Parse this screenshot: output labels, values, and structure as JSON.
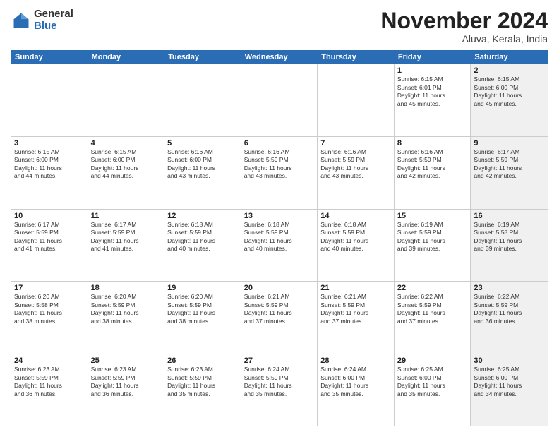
{
  "logo": {
    "general": "General",
    "blue": "Blue"
  },
  "title": "November 2024",
  "location": "Aluva, Kerala, India",
  "days_of_week": [
    "Sunday",
    "Monday",
    "Tuesday",
    "Wednesday",
    "Thursday",
    "Friday",
    "Saturday"
  ],
  "weeks": [
    [
      {
        "day": "",
        "info": "",
        "shaded": false
      },
      {
        "day": "",
        "info": "",
        "shaded": false
      },
      {
        "day": "",
        "info": "",
        "shaded": false
      },
      {
        "day": "",
        "info": "",
        "shaded": false
      },
      {
        "day": "",
        "info": "",
        "shaded": false
      },
      {
        "day": "1",
        "info": "Sunrise: 6:15 AM\nSunset: 6:01 PM\nDaylight: 11 hours\nand 45 minutes.",
        "shaded": false
      },
      {
        "day": "2",
        "info": "Sunrise: 6:15 AM\nSunset: 6:00 PM\nDaylight: 11 hours\nand 45 minutes.",
        "shaded": true
      }
    ],
    [
      {
        "day": "3",
        "info": "Sunrise: 6:15 AM\nSunset: 6:00 PM\nDaylight: 11 hours\nand 44 minutes.",
        "shaded": false
      },
      {
        "day": "4",
        "info": "Sunrise: 6:15 AM\nSunset: 6:00 PM\nDaylight: 11 hours\nand 44 minutes.",
        "shaded": false
      },
      {
        "day": "5",
        "info": "Sunrise: 6:16 AM\nSunset: 6:00 PM\nDaylight: 11 hours\nand 43 minutes.",
        "shaded": false
      },
      {
        "day": "6",
        "info": "Sunrise: 6:16 AM\nSunset: 5:59 PM\nDaylight: 11 hours\nand 43 minutes.",
        "shaded": false
      },
      {
        "day": "7",
        "info": "Sunrise: 6:16 AM\nSunset: 5:59 PM\nDaylight: 11 hours\nand 43 minutes.",
        "shaded": false
      },
      {
        "day": "8",
        "info": "Sunrise: 6:16 AM\nSunset: 5:59 PM\nDaylight: 11 hours\nand 42 minutes.",
        "shaded": false
      },
      {
        "day": "9",
        "info": "Sunrise: 6:17 AM\nSunset: 5:59 PM\nDaylight: 11 hours\nand 42 minutes.",
        "shaded": true
      }
    ],
    [
      {
        "day": "10",
        "info": "Sunrise: 6:17 AM\nSunset: 5:59 PM\nDaylight: 11 hours\nand 41 minutes.",
        "shaded": false
      },
      {
        "day": "11",
        "info": "Sunrise: 6:17 AM\nSunset: 5:59 PM\nDaylight: 11 hours\nand 41 minutes.",
        "shaded": false
      },
      {
        "day": "12",
        "info": "Sunrise: 6:18 AM\nSunset: 5:59 PM\nDaylight: 11 hours\nand 40 minutes.",
        "shaded": false
      },
      {
        "day": "13",
        "info": "Sunrise: 6:18 AM\nSunset: 5:59 PM\nDaylight: 11 hours\nand 40 minutes.",
        "shaded": false
      },
      {
        "day": "14",
        "info": "Sunrise: 6:18 AM\nSunset: 5:59 PM\nDaylight: 11 hours\nand 40 minutes.",
        "shaded": false
      },
      {
        "day": "15",
        "info": "Sunrise: 6:19 AM\nSunset: 5:59 PM\nDaylight: 11 hours\nand 39 minutes.",
        "shaded": false
      },
      {
        "day": "16",
        "info": "Sunrise: 6:19 AM\nSunset: 5:58 PM\nDaylight: 11 hours\nand 39 minutes.",
        "shaded": true
      }
    ],
    [
      {
        "day": "17",
        "info": "Sunrise: 6:20 AM\nSunset: 5:58 PM\nDaylight: 11 hours\nand 38 minutes.",
        "shaded": false
      },
      {
        "day": "18",
        "info": "Sunrise: 6:20 AM\nSunset: 5:59 PM\nDaylight: 11 hours\nand 38 minutes.",
        "shaded": false
      },
      {
        "day": "19",
        "info": "Sunrise: 6:20 AM\nSunset: 5:59 PM\nDaylight: 11 hours\nand 38 minutes.",
        "shaded": false
      },
      {
        "day": "20",
        "info": "Sunrise: 6:21 AM\nSunset: 5:59 PM\nDaylight: 11 hours\nand 37 minutes.",
        "shaded": false
      },
      {
        "day": "21",
        "info": "Sunrise: 6:21 AM\nSunset: 5:59 PM\nDaylight: 11 hours\nand 37 minutes.",
        "shaded": false
      },
      {
        "day": "22",
        "info": "Sunrise: 6:22 AM\nSunset: 5:59 PM\nDaylight: 11 hours\nand 37 minutes.",
        "shaded": false
      },
      {
        "day": "23",
        "info": "Sunrise: 6:22 AM\nSunset: 5:59 PM\nDaylight: 11 hours\nand 36 minutes.",
        "shaded": true
      }
    ],
    [
      {
        "day": "24",
        "info": "Sunrise: 6:23 AM\nSunset: 5:59 PM\nDaylight: 11 hours\nand 36 minutes.",
        "shaded": false
      },
      {
        "day": "25",
        "info": "Sunrise: 6:23 AM\nSunset: 5:59 PM\nDaylight: 11 hours\nand 36 minutes.",
        "shaded": false
      },
      {
        "day": "26",
        "info": "Sunrise: 6:23 AM\nSunset: 5:59 PM\nDaylight: 11 hours\nand 35 minutes.",
        "shaded": false
      },
      {
        "day": "27",
        "info": "Sunrise: 6:24 AM\nSunset: 5:59 PM\nDaylight: 11 hours\nand 35 minutes.",
        "shaded": false
      },
      {
        "day": "28",
        "info": "Sunrise: 6:24 AM\nSunset: 6:00 PM\nDaylight: 11 hours\nand 35 minutes.",
        "shaded": false
      },
      {
        "day": "29",
        "info": "Sunrise: 6:25 AM\nSunset: 6:00 PM\nDaylight: 11 hours\nand 35 minutes.",
        "shaded": false
      },
      {
        "day": "30",
        "info": "Sunrise: 6:25 AM\nSunset: 6:00 PM\nDaylight: 11 hours\nand 34 minutes.",
        "shaded": true
      }
    ]
  ]
}
